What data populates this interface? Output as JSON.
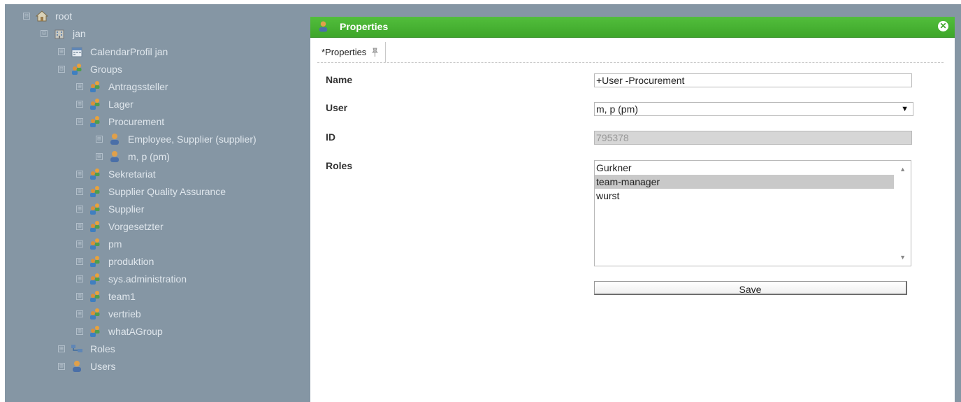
{
  "tree": {
    "root": {
      "label": "root",
      "toggle": "⊟",
      "icon": "home-icon"
    },
    "user": {
      "label": "jan",
      "toggle": "⊟",
      "icon": "building-icon"
    },
    "calendar": {
      "label": "CalendarProfil jan",
      "toggle": "⊞",
      "icon": "calendar-icon"
    },
    "groups": {
      "label": "Groups",
      "toggle": "⊟",
      "icon": "group-icon"
    },
    "antragssteller": {
      "label": "Antragssteller",
      "toggle": "⊞"
    },
    "lager": {
      "label": "Lager",
      "toggle": "⊞"
    },
    "procurement": {
      "label": "Procurement",
      "toggle": "⊟"
    },
    "procurement_members": [
      {
        "label": "Employee, Supplier (supplier)",
        "toggle": "⊞",
        "icon": "user-icon"
      },
      {
        "label": "m, p (pm)",
        "toggle": "⊞",
        "icon": "user-icon"
      }
    ],
    "more_groups": [
      {
        "label": "Sekretariat",
        "toggle": "⊞"
      },
      {
        "label": "Supplier Quality Assurance",
        "toggle": "⊞"
      },
      {
        "label": "Supplier",
        "toggle": "⊞"
      },
      {
        "label": "Vorgesetzter",
        "toggle": "⊞"
      },
      {
        "label": "pm",
        "toggle": "⊞"
      },
      {
        "label": "produktion",
        "toggle": "⊞"
      },
      {
        "label": "sys.administration",
        "toggle": "⊞"
      },
      {
        "label": "team1",
        "toggle": "⊞"
      },
      {
        "label": "vertrieb",
        "toggle": "⊞"
      },
      {
        "label": "whatAGroup",
        "toggle": "⊞"
      }
    ],
    "roles": {
      "label": "Roles",
      "toggle": "⊞",
      "icon": "roles-icon"
    },
    "users": {
      "label": "Users",
      "toggle": "⊞",
      "icon": "user-icon"
    }
  },
  "dialog": {
    "title": "Properties",
    "close_icon": "close-icon",
    "close_glyph": "✕",
    "tab_label": "*Properties",
    "tab_icon": "pin-icon"
  },
  "form": {
    "name_label": "Name",
    "name_value": "+User -Procurement",
    "user_label": "User",
    "user_value": "m, p (pm)",
    "user_arrow": "▼",
    "id_label": "ID",
    "id_value": "795378",
    "roles_label": "Roles",
    "roles": [
      "Gurkner",
      "team-manager",
      "wurst"
    ],
    "roles_selected": "team-manager",
    "scroll_up": "▲",
    "scroll_down": "▼",
    "save_label": "Save"
  },
  "colors": {
    "header_green": "#46b030",
    "overlay": "#8596a4"
  }
}
